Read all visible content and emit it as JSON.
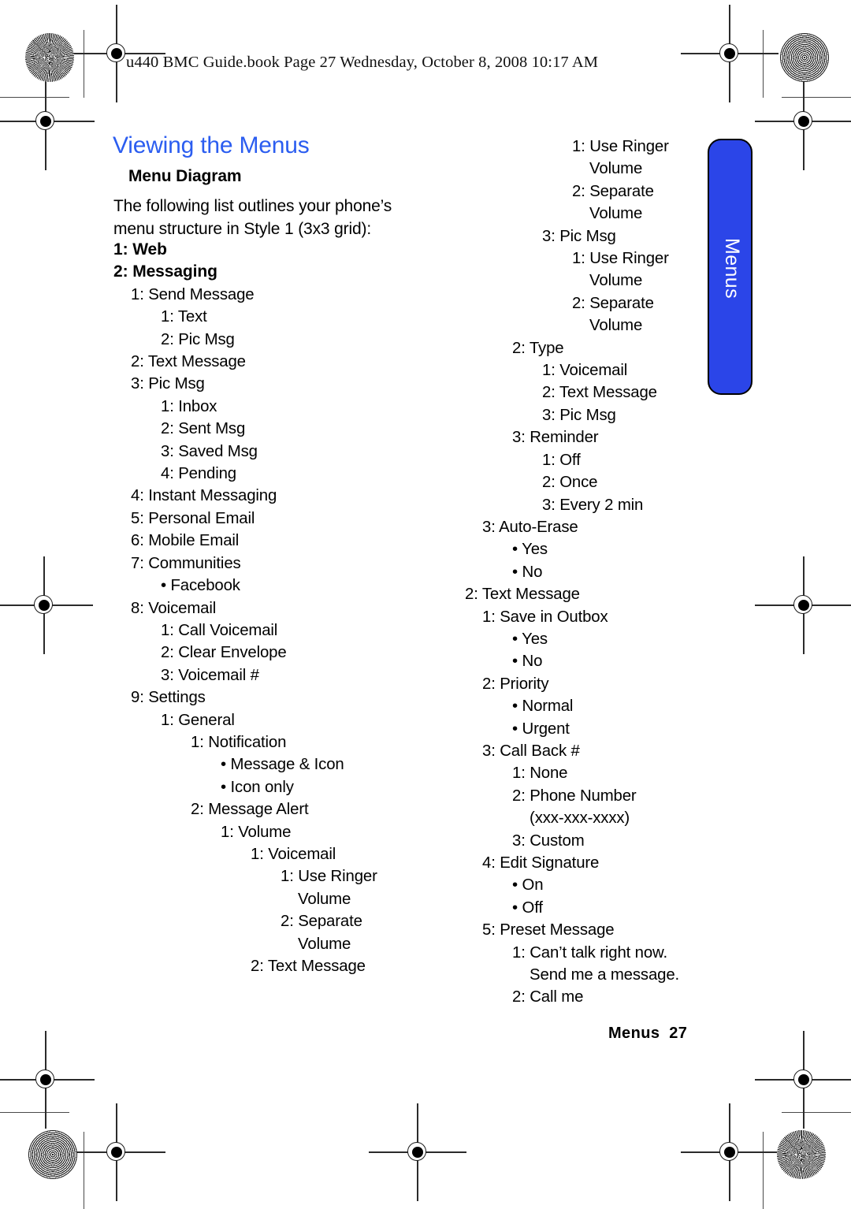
{
  "running_header": "u440 BMC Guide.book  Page 27  Wednesday, October 8, 2008  10:17 AM",
  "page": {
    "title": "Viewing the Menus",
    "subhead": "Menu Diagram",
    "intro": "The following list outlines your phone’s menu structure in Style 1 (3x3 grid):",
    "folio": "Menus  27",
    "thumb_tab": "Menus",
    "title_color": "#2b5df0",
    "tab_color": "#2b45e8"
  },
  "left_column": [
    {
      "indent": 0,
      "bold": true,
      "text": "1: Web"
    },
    {
      "indent": 0,
      "bold": true,
      "text": "2: Messaging"
    },
    {
      "indent": 1,
      "bold": false,
      "text": "1: Send Message"
    },
    {
      "indent": 2,
      "bold": false,
      "text": "1: Text"
    },
    {
      "indent": 2,
      "bold": false,
      "text": "2: Pic Msg"
    },
    {
      "indent": 1,
      "bold": false,
      "text": "2: Text Message"
    },
    {
      "indent": 1,
      "bold": false,
      "text": "3: Pic Msg"
    },
    {
      "indent": 2,
      "bold": false,
      "text": "1: Inbox"
    },
    {
      "indent": 2,
      "bold": false,
      "text": "2: Sent Msg"
    },
    {
      "indent": 2,
      "bold": false,
      "text": "3: Saved Msg"
    },
    {
      "indent": 2,
      "bold": false,
      "text": "4: Pending"
    },
    {
      "indent": 1,
      "bold": false,
      "text": "4: Instant Messaging"
    },
    {
      "indent": 1,
      "bold": false,
      "text": "5: Personal Email"
    },
    {
      "indent": 1,
      "bold": false,
      "text": "6: Mobile Email"
    },
    {
      "indent": 1,
      "bold": false,
      "text": "7: Communities"
    },
    {
      "indent": 2,
      "bold": false,
      "text": "• Facebook"
    },
    {
      "indent": 1,
      "bold": false,
      "text": "8: Voicemail"
    },
    {
      "indent": 2,
      "bold": false,
      "text": "1: Call Voicemail"
    },
    {
      "indent": 2,
      "bold": false,
      "text": "2: Clear Envelope"
    },
    {
      "indent": 2,
      "bold": false,
      "text": "3: Voicemail #"
    },
    {
      "indent": 1,
      "bold": false,
      "text": "9: Settings"
    },
    {
      "indent": 2,
      "bold": false,
      "text": "1: General"
    },
    {
      "indent": 3,
      "bold": false,
      "text": "1: Notification"
    },
    {
      "indent": 4,
      "bold": false,
      "text": "• Message & Icon"
    },
    {
      "indent": 4,
      "bold": false,
      "text": "• Icon only"
    },
    {
      "indent": 3,
      "bold": false,
      "text": "2: Message Alert"
    },
    {
      "indent": 4,
      "bold": false,
      "text": "1: Volume"
    },
    {
      "indent": 5,
      "bold": false,
      "text": "1: Voicemail"
    },
    {
      "indent": 6,
      "bold": false,
      "text": "1: Use Ringer"
    },
    {
      "indent": 6,
      "bold": false,
      "text": "    Volume"
    },
    {
      "indent": 6,
      "bold": false,
      "text": "2: Separate"
    },
    {
      "indent": 6,
      "bold": false,
      "text": "    Volume"
    },
    {
      "indent": 5,
      "bold": false,
      "text": "2: Text Message"
    }
  ],
  "right_column": [
    {
      "indent": 4,
      "bold": false,
      "text": "1: Use Ringer"
    },
    {
      "indent": 4,
      "bold": false,
      "text": "    Volume"
    },
    {
      "indent": 4,
      "bold": false,
      "text": "2: Separate"
    },
    {
      "indent": 4,
      "bold": false,
      "text": "    Volume"
    },
    {
      "indent": 3,
      "bold": false,
      "text": "3: Pic Msg"
    },
    {
      "indent": 4,
      "bold": false,
      "text": "1: Use Ringer"
    },
    {
      "indent": 4,
      "bold": false,
      "text": "    Volume"
    },
    {
      "indent": 4,
      "bold": false,
      "text": "2: Separate"
    },
    {
      "indent": 4,
      "bold": false,
      "text": "    Volume"
    },
    {
      "indent": 2,
      "bold": false,
      "text": "2: Type"
    },
    {
      "indent": 3,
      "bold": false,
      "text": "1: Voicemail"
    },
    {
      "indent": 3,
      "bold": false,
      "text": "2: Text Message"
    },
    {
      "indent": 3,
      "bold": false,
      "text": "3: Pic Msg"
    },
    {
      "indent": 2,
      "bold": false,
      "text": "3: Reminder"
    },
    {
      "indent": 3,
      "bold": false,
      "text": "1: Off"
    },
    {
      "indent": 3,
      "bold": false,
      "text": "2: Once"
    },
    {
      "indent": 3,
      "bold": false,
      "text": "3: Every 2 min"
    },
    {
      "indent": 1,
      "bold": false,
      "text": "3: Auto-Erase"
    },
    {
      "indent": 2,
      "bold": false,
      "text": "• Yes"
    },
    {
      "indent": 2,
      "bold": false,
      "text": "• No"
    },
    {
      "indent": 0,
      "bold": false,
      "text": "2: Text Message"
    },
    {
      "indent": 1,
      "bold": false,
      "text": "1: Save in Outbox"
    },
    {
      "indent": 2,
      "bold": false,
      "text": "• Yes"
    },
    {
      "indent": 2,
      "bold": false,
      "text": "• No"
    },
    {
      "indent": 1,
      "bold": false,
      "text": "2: Priority"
    },
    {
      "indent": 2,
      "bold": false,
      "text": "• Normal"
    },
    {
      "indent": 2,
      "bold": false,
      "text": "• Urgent"
    },
    {
      "indent": 1,
      "bold": false,
      "text": "3: Call Back #"
    },
    {
      "indent": 2,
      "bold": false,
      "text": "1: None"
    },
    {
      "indent": 2,
      "bold": false,
      "text": "2: Phone Number"
    },
    {
      "indent": 2,
      "bold": false,
      "text": "    (xxx-xxx-xxxx)"
    },
    {
      "indent": 2,
      "bold": false,
      "text": "3: Custom"
    },
    {
      "indent": 1,
      "bold": false,
      "text": "4: Edit Signature"
    },
    {
      "indent": 2,
      "bold": false,
      "text": "• On"
    },
    {
      "indent": 2,
      "bold": false,
      "text": "• Off"
    },
    {
      "indent": 1,
      "bold": false,
      "text": "5: Preset Message"
    },
    {
      "indent": 2,
      "bold": false,
      "text": "1: Can’t talk right now."
    },
    {
      "indent": 2,
      "bold": false,
      "text": "    Send me a message."
    },
    {
      "indent": 2,
      "bold": false,
      "text": "2: Call me"
    }
  ]
}
